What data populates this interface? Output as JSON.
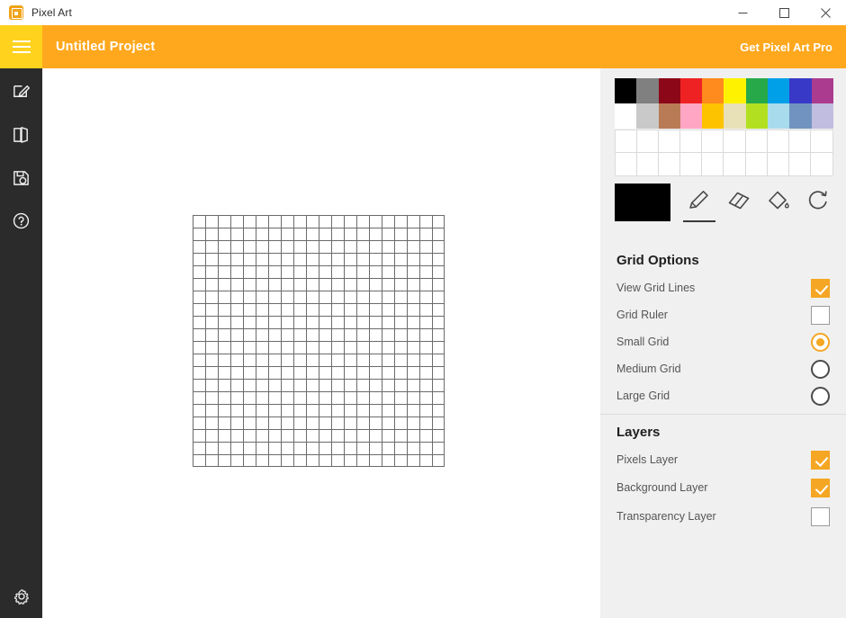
{
  "window": {
    "app_title": "Pixel Art",
    "app_icon": "pixel-art-app-icon",
    "controls": {
      "minimize": "minimize-icon",
      "maximize": "maximize-icon",
      "close": "close-icon"
    }
  },
  "header": {
    "menu_icon": "hamburger-menu-icon",
    "project_title": "Untitled Project",
    "pro_link": "Get Pixel Art Pro",
    "background_color": "#ffa81e",
    "menu_background_color": "#ffd21e"
  },
  "rail": {
    "items": [
      {
        "name": "new-project",
        "icon": "pencil-square-icon"
      },
      {
        "name": "open-project",
        "icon": "book-open-icon"
      },
      {
        "name": "save-project",
        "icon": "floppy-save-icon"
      },
      {
        "name": "help",
        "icon": "question-circle-icon"
      }
    ],
    "bottom": {
      "name": "settings",
      "icon": "gear-icon"
    },
    "background_color": "#2b2b2b"
  },
  "canvas": {
    "columns": 20,
    "rows": 20,
    "cell_size_px": 14,
    "grid_color": "#6b6b6b",
    "fill_color": "#ffffff"
  },
  "palette": {
    "row1": [
      "#000000",
      "#808080",
      "#8c0718",
      "#ee2222",
      "#ff8a1e",
      "#fff200",
      "#27a94a",
      "#00a0e9",
      "#3939c8",
      "#ab3b8e"
    ],
    "row2": [
      "#ffffff",
      "#c9c9c9",
      "#b97b56",
      "#ffa6c4",
      "#fdc300",
      "#e8e0b6",
      "#b2e021",
      "#a8dced",
      "#7094bf",
      "#c1bde0"
    ],
    "custom_slots_rows": 2,
    "custom_slots_per_row": 10,
    "custom_slot_color": "#ffffff"
  },
  "tools": {
    "current_color": "#000000",
    "items": [
      {
        "name": "pencil-tool",
        "icon": "pencil-icon",
        "selected": true
      },
      {
        "name": "eraser-tool",
        "icon": "eraser-icon",
        "selected": false
      },
      {
        "name": "fill-tool",
        "icon": "paint-bucket-icon",
        "selected": false
      },
      {
        "name": "reset-tool",
        "icon": "refresh-icon",
        "selected": false
      }
    ]
  },
  "grid_options": {
    "title": "Grid Options",
    "checkboxes": [
      {
        "label": "View Grid Lines",
        "checked": true
      },
      {
        "label": "Grid Ruler",
        "checked": false
      }
    ],
    "radios": [
      {
        "label": "Small Grid",
        "selected": true
      },
      {
        "label": "Medium Grid",
        "selected": false
      },
      {
        "label": "Large Grid",
        "selected": false
      }
    ]
  },
  "layers": {
    "title": "Layers",
    "items": [
      {
        "label": "Pixels Layer",
        "checked": true
      },
      {
        "label": "Background Layer",
        "checked": true
      },
      {
        "label": "Transparency Layer",
        "checked": false
      }
    ]
  },
  "accent_color": "#f5a623"
}
